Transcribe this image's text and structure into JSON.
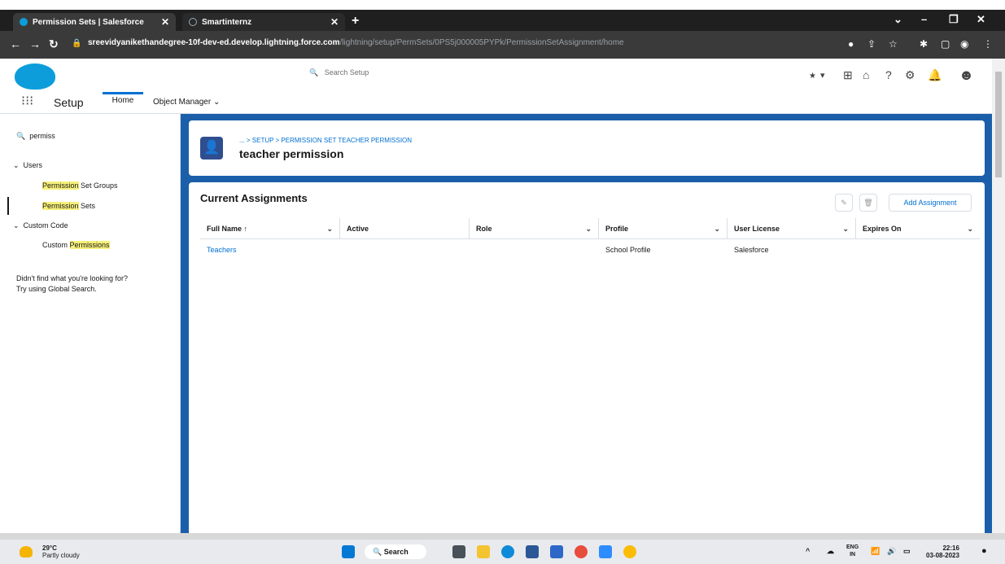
{
  "browser": {
    "tabs": [
      {
        "label": "Permission Sets | Salesforce",
        "active": true
      },
      {
        "label": "Smartinternz",
        "active": false
      }
    ],
    "url_host": "sreevidyanikethandegree-10f-dev-ed.develop.lightning.force.com",
    "url_path": "/lightning/setup/PermSets/0PS5j000005PYPk/PermissionSetAssignment/home"
  },
  "header": {
    "search_placeholder": "Search Setup",
    "app_name": "Setup",
    "nav_tabs": [
      "Home",
      "Object Manager"
    ]
  },
  "sidebar": {
    "quick_find_value": "permiss",
    "sections": [
      {
        "label": "Users",
        "items": [
          {
            "highlight": "Permission",
            "rest": " Set Groups"
          },
          {
            "highlight": "Permission",
            "rest": " Sets"
          }
        ]
      },
      {
        "label": "Custom Code",
        "items": [
          {
            "prefix": "Custom ",
            "highlight": "Permissions"
          }
        ]
      }
    ],
    "note_line1": "Didn't find what you're looking for?",
    "note_line2": "Try using Global Search."
  },
  "record": {
    "breadcrumb": "... > SETUP > PERMISSION SET TEACHER PERMISSION",
    "title": "teacher permission"
  },
  "list": {
    "title": "Current Assignments",
    "add_button": "Add Assignment",
    "columns": [
      "Full Name ↑",
      "Active",
      "Role",
      "Profile",
      "User License",
      "Expires On"
    ],
    "rows": [
      {
        "full_name": "Teachers",
        "active": "",
        "role": "",
        "profile": "School Profile",
        "user_license": "Salesforce",
        "expires_on": ""
      }
    ]
  },
  "taskbar": {
    "temp": "29°C",
    "weather": "Partly cloudy",
    "search_label": "Search",
    "lang_top": "ENG",
    "lang_bottom": "IN",
    "time": "22:16",
    "date": "03-08-2023"
  },
  "colors": {
    "brand_blue": "#0070d2",
    "main_bg": "#1b5faa",
    "highlight": "#f6f07a"
  }
}
